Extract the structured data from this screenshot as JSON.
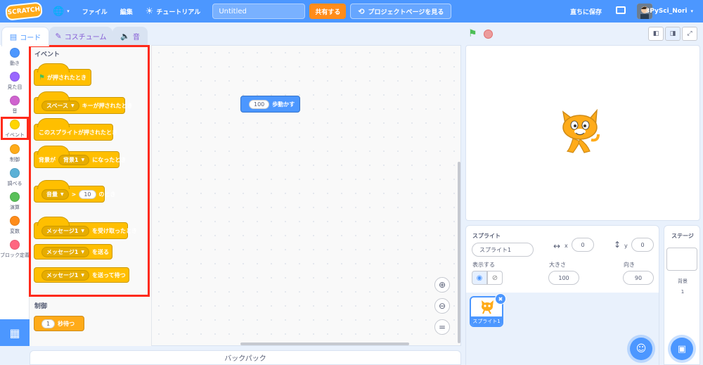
{
  "menubar": {
    "logo": "SCRATCH",
    "file": "ファイル",
    "edit": "編集",
    "tutorial": "チュートリアル",
    "project_title": "Untitled",
    "share": "共有する",
    "project_page": "プロジェクトページを見る",
    "save_now": "直ちに保存",
    "username": "3PySci_Nori"
  },
  "tabs": {
    "code": "コード",
    "costumes": "コスチューム",
    "sounds": "音"
  },
  "categories": [
    {
      "label": "動き",
      "color": "#4c97ff"
    },
    {
      "label": "見た目",
      "color": "#9966ff"
    },
    {
      "label": "音",
      "color": "#cf63cf"
    },
    {
      "label": "イベント",
      "color": "#ffd500"
    },
    {
      "label": "制御",
      "color": "#ffab19"
    },
    {
      "label": "調べる",
      "color": "#5cb1d6"
    },
    {
      "label": "演算",
      "color": "#59c059"
    },
    {
      "label": "変数",
      "color": "#ff8c1a"
    },
    {
      "label": "ブロック定義",
      "color": "#ff6680"
    }
  ],
  "palette": {
    "events_title": "イベント",
    "flag_clicked": "が押されたとき",
    "key_dd": "スペース",
    "key_pressed": "キーが押されたとき",
    "sprite_clicked": "このスプライトが押されたとき",
    "backdrop_prefix": "背景が",
    "backdrop_dd": "背景1",
    "backdrop_suffix": "になったとき",
    "sensor_dd": "音量",
    "gt": ">",
    "sensor_value": "10",
    "sensor_suffix": "のとき",
    "msg_dd": "メッセージ1",
    "msg_received": "を受け取ったとき",
    "broadcast": "を送る",
    "broadcast_wait": "を送って待つ",
    "control_title": "制御",
    "wait_value": "1",
    "wait_suffix": "秒待つ"
  },
  "script": {
    "move_value": "100",
    "move_label": "歩動かす"
  },
  "backpack": "バックパック",
  "sprite_info": {
    "sprite_label": "スプライト",
    "sprite_name": "スプライト1",
    "x_label": "x",
    "x_value": "0",
    "y_label": "y",
    "y_value": "0",
    "show_label": "表示する",
    "size_label": "大きさ",
    "size_value": "100",
    "direction_label": "向き",
    "direction_value": "90"
  },
  "sprite_list": [
    {
      "name": "スプライト1"
    }
  ],
  "stage_pane": {
    "title": "ステージ",
    "backdrops_label": "背景",
    "backdrops_count": "1"
  }
}
